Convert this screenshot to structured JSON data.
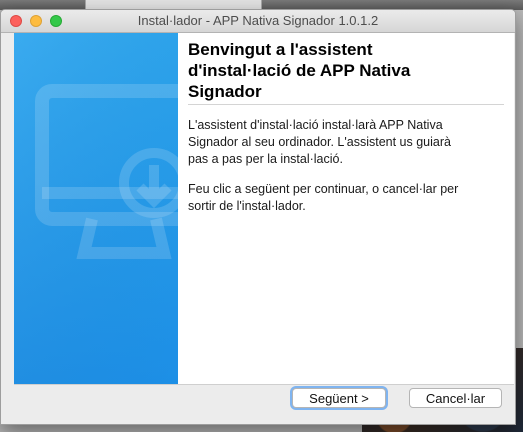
{
  "window": {
    "title": "Instal·lador - APP Nativa Signador 1.0.1.2"
  },
  "content": {
    "heading": "Benvingut a l'assistent\nd'instal·lació de APP Nativa\nSignador",
    "paragraph1": "L'assistent d'instal·lació instal·larà APP Nativa\nSignador al seu ordinador. L'assistent us guiarà\npas a pas per la instal·lació.",
    "paragraph2": "Feu clic a següent per continuar, o cancel·lar per\nsortir de l'instal·lador."
  },
  "buttons": {
    "next_label": "Següent >",
    "cancel_label": "Cancel·lar"
  },
  "colors": {
    "side_panel": "#1d8fe6",
    "focus_ring": "#7fb4f0"
  },
  "icons": {
    "side_graphic": "monitor-download-icon"
  }
}
